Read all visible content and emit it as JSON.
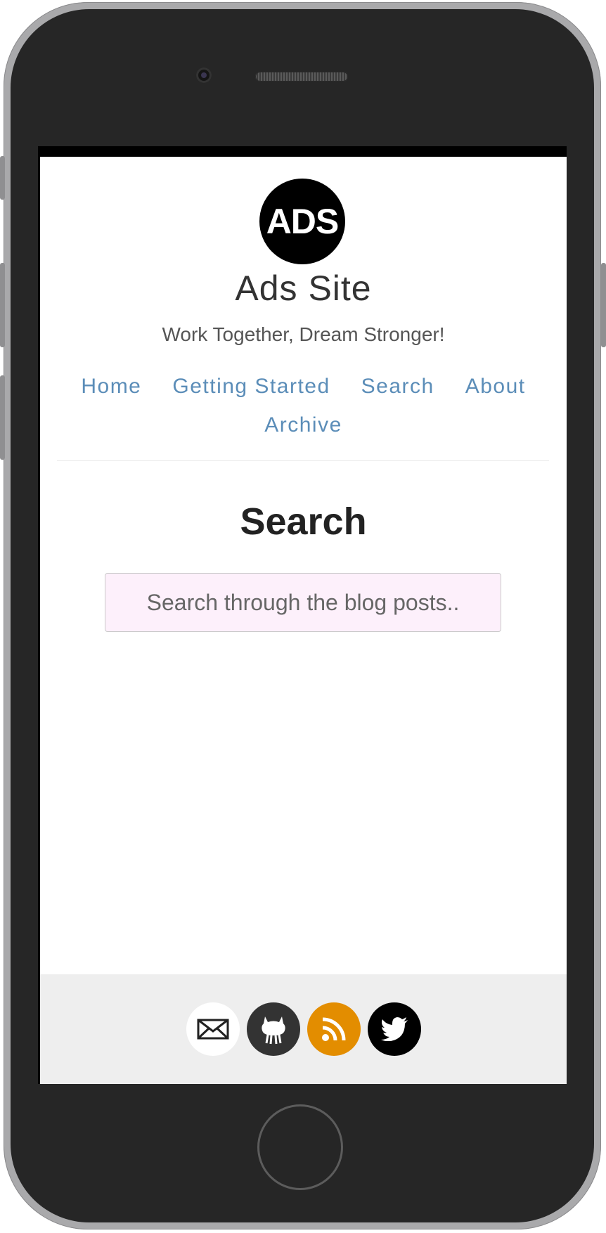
{
  "logo": {
    "text": "ADS"
  },
  "site": {
    "title": "Ads Site",
    "tagline": "Work Together, Dream Stronger!"
  },
  "nav": {
    "items": [
      {
        "label": "Home"
      },
      {
        "label": "Getting Started"
      },
      {
        "label": "Search"
      },
      {
        "label": "About"
      },
      {
        "label": "Archive"
      }
    ]
  },
  "main": {
    "title": "Search",
    "search": {
      "placeholder": "Search through the blog posts..",
      "value": ""
    }
  },
  "footer": {
    "social": [
      {
        "icon": "email-icon",
        "color": "#ffffff"
      },
      {
        "icon": "github-icon",
        "color": "#333333"
      },
      {
        "icon": "rss-icon",
        "color": "#e38d00"
      },
      {
        "icon": "twitter-icon",
        "color": "#000000"
      }
    ]
  },
  "colors": {
    "link": "#5b8db8",
    "footer_bg": "#eeeeee",
    "search_bg": "#fdf0fb"
  }
}
